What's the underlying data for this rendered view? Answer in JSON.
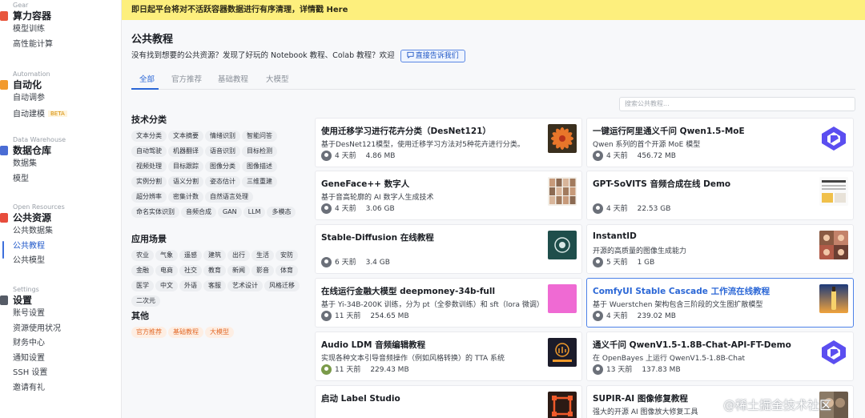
{
  "banner": {
    "text": "即日起平台将对不活跃容器数据进行有序清理，详情戳 Here"
  },
  "sidebar": {
    "sections": [
      {
        "en": "Gear",
        "title": "算力容器",
        "icon_color": "#e8563d",
        "items": [
          {
            "label": "模型训练"
          },
          {
            "label": "高性能计算"
          }
        ]
      },
      {
        "en": "Automation",
        "title": "自动化",
        "icon_color": "#f29a2e",
        "items": [
          {
            "label": "自动调参"
          },
          {
            "label": "自动建模",
            "badge": "BETA"
          }
        ]
      },
      {
        "en": "Data Warehouse",
        "title": "数据仓库",
        "icon_color": "#4a6cd4",
        "items": [
          {
            "label": "数据集"
          },
          {
            "label": "模型"
          }
        ]
      },
      {
        "en": "Open Resources",
        "title": "公共资源",
        "icon_color": "#e74c3c",
        "items": [
          {
            "label": "公共数据集"
          },
          {
            "label": "公共教程",
            "active": true
          },
          {
            "label": "公共模型"
          }
        ]
      },
      {
        "en": "Settings",
        "title": "设置",
        "icon_color": "#555b66",
        "items": [
          {
            "label": "账号设置"
          },
          {
            "label": "资源使用状况"
          },
          {
            "label": "财务中心"
          },
          {
            "label": "通知设置"
          },
          {
            "label": "SSH 设置"
          },
          {
            "label": "邀请有礼"
          }
        ]
      }
    ]
  },
  "header": {
    "title": "公共教程",
    "subline": "没有找到想要的公共资源？发现了好玩的 Notebook 教程、Colab 教程？欢迎",
    "contact_button": "直接告诉我们"
  },
  "tabs": [
    {
      "label": "全部",
      "active": true
    },
    {
      "label": "官方推荐"
    },
    {
      "label": "基础教程"
    },
    {
      "label": "大模型"
    }
  ],
  "search": {
    "placeholder": "搜索公共教程..."
  },
  "filters": [
    {
      "title": "技术分类",
      "chips": [
        "文本分类",
        "文本摘要",
        "情绪识别",
        "智能问答",
        "自动驾驶",
        "机器翻译",
        "语音识别",
        "目标检测",
        "视频处理",
        "目标跟踪",
        "图像分类",
        "图像描述",
        "实例分割",
        "语义分割",
        "姿态估计",
        "三维重建",
        "超分辨率",
        "密集计数",
        "自然语言处理",
        "命名实体识别",
        "音频合成",
        "GAN",
        "LLM",
        "多模态"
      ]
    },
    {
      "title": "应用场景",
      "chips": [
        "农业",
        "气象",
        "遥感",
        "建筑",
        "出行",
        "生活",
        "安防",
        "金融",
        "电商",
        "社交",
        "教育",
        "新闻",
        "影音",
        "体育",
        "医学",
        "中文",
        "外语",
        "客服",
        "艺术设计",
        "风格迁移",
        "二次元"
      ]
    },
    {
      "title": "其他",
      "chips": [
        "官方推荐",
        "基础教程",
        "大模型"
      ],
      "style": "orange"
    }
  ],
  "cards": [
    {
      "title": "使用迁移学习进行花卉分类（DesNet121）",
      "desc": "基于DesNet121模型，使用迁移学习方法对5种花卉进行分类。",
      "time": "4 天前",
      "size": "4.86 MB",
      "thumb": "flower"
    },
    {
      "title": "一键运行阿里通义千问 Qwen1.5-MoE",
      "desc": "Qwen 系列的首个开源 MoE 模型",
      "time": "4 天前",
      "size": "456.72 MB",
      "thumb": "qwen"
    },
    {
      "title": "GeneFace++ 数字人",
      "desc": "基于音高轮廓的 AI 数字人生成技术",
      "time": "4 天前",
      "size": "3.06 GB",
      "thumb": "faces"
    },
    {
      "title": "GPT-SoVITS 音频合成在线 Demo",
      "desc": "",
      "time": "4 天前",
      "size": "22.53 GB",
      "thumb": "sovits"
    },
    {
      "title": "Stable-Diffusion 在线教程",
      "desc": "",
      "time": "6 天前",
      "size": "3.4 GB",
      "thumb": "sd"
    },
    {
      "title": "InstantID",
      "desc": "开源的高质量的图像生成能力",
      "time": "5 天前",
      "size": "1 GB",
      "thumb": "instant"
    },
    {
      "title": "在线运行金融大模型 deepmoney-34b-full",
      "desc": "基于 Yi-34B-200K 训练，分为 pt（全参数训练）和 sft（lora 微调）",
      "time": "11 天前",
      "size": "254.65 MB",
      "thumb": "pink"
    },
    {
      "title": "ComfyUI Stable Cascade 工作流在线教程",
      "desc": "基于 Wuerstchen 架构包含三阶段的文生图扩散模型",
      "time": "4 天前",
      "size": "239.02 MB",
      "thumb": "cascade",
      "highlight": true
    },
    {
      "title": "Audio LDM 音频编辑教程",
      "desc": "实现各种文本引导音频操作（例如风格转换）的 TTA 系统",
      "time": "11 天前",
      "size": "229.43 MB",
      "thumb": "audio"
    },
    {
      "title": "通义千问 QwenV1.5-1.8B-Chat-API-FT-Demo",
      "desc": "在 OpenBayes 上运行 QwenV1.5-1.8B-Chat",
      "time": "13 天前",
      "size": "137.83 MB",
      "thumb": "qwen"
    },
    {
      "title": "启动 Label Studio",
      "desc": "",
      "time": "",
      "size": "",
      "thumb": "label"
    },
    {
      "title": "SUPIR-AI 图像修复教程",
      "desc": "强大的开源 AI 图像放大修复工具",
      "time": "",
      "size": "",
      "thumb": "supir"
    }
  ],
  "watermark": "@稀土掘金技术社区",
  "colors": {
    "accent": "#2b67d6",
    "banner": "#fdef7d",
    "arrow": "#e53a2c"
  }
}
